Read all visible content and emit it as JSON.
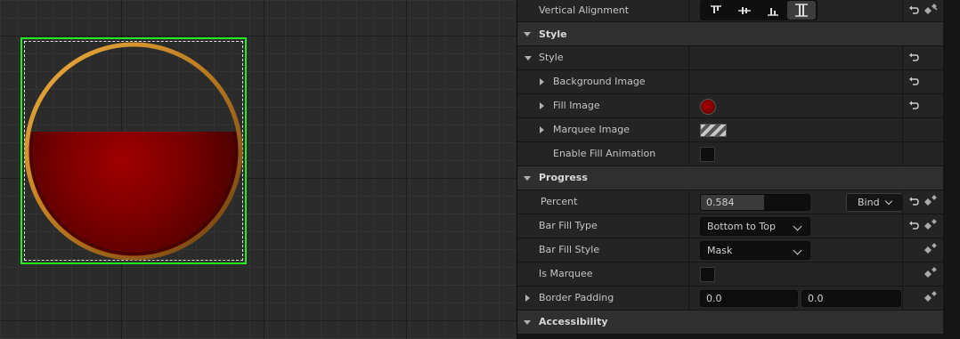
{
  "panel": {
    "vertical_alignment": {
      "label": "Vertical Alignment"
    },
    "style_section": {
      "label": "Style"
    },
    "style_group": {
      "label": "Style"
    },
    "background_image": {
      "label": "Background Image"
    },
    "fill_image": {
      "label": "Fill Image"
    },
    "marquee_image": {
      "label": "Marquee Image"
    },
    "enable_fill_animation": {
      "label": "Enable Fill Animation",
      "checked": false
    },
    "progress_section": {
      "label": "Progress"
    },
    "percent": {
      "label": "Percent",
      "value": "0.584",
      "fraction": 0.584,
      "bind_label": "Bind"
    },
    "bar_fill_type": {
      "label": "Bar Fill Type",
      "value": "Bottom to Top"
    },
    "bar_fill_style": {
      "label": "Bar Fill Style",
      "value": "Mask"
    },
    "is_marquee": {
      "label": "Is Marquee",
      "checked": false
    },
    "border_padding": {
      "label": "Border Padding",
      "value_a": "0.0",
      "value_b": "0.0"
    },
    "accessibility_section": {
      "label": "Accessibility"
    }
  },
  "viewport": {
    "selection_color": "#22ee22",
    "fill_color": "#8a0000",
    "ring_color": "#d99a2e"
  }
}
